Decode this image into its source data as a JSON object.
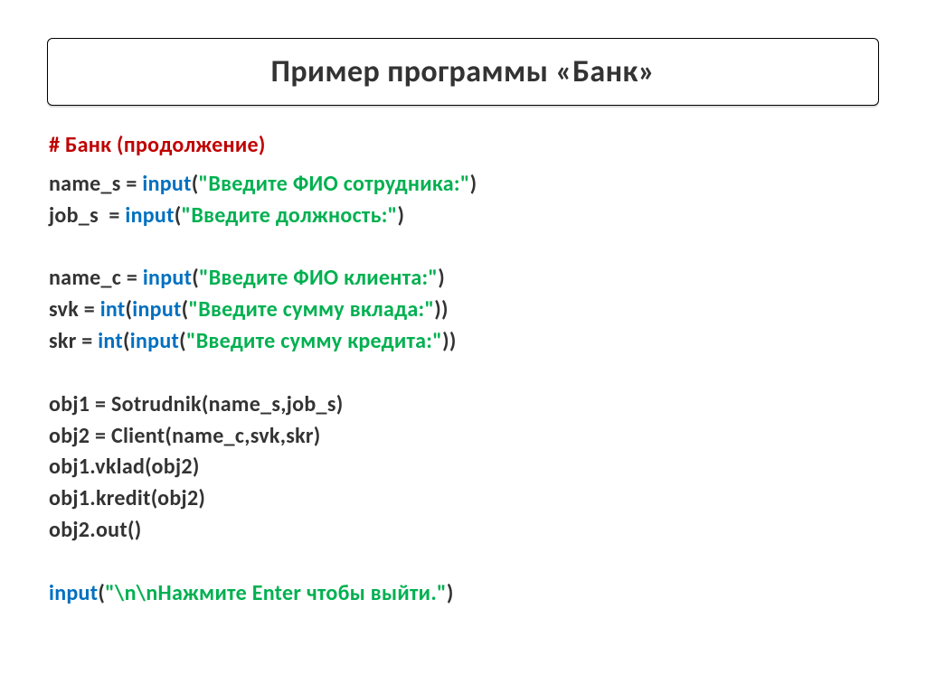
{
  "title": "Пример программы «Банк»",
  "comment": "# Банк (продолжение)",
  "code": {
    "l1": {
      "a": "name_s = ",
      "b": "input",
      "c": "(",
      "d": "\"Введите ФИО сотрудника:\"",
      "e": ")"
    },
    "l2": {
      "a": "job_s  = ",
      "b": "input",
      "c": "(",
      "d": "\"Введите должность:\"",
      "e": ")"
    },
    "l3": {
      "a": "name_c = ",
      "b": "input",
      "c": "(",
      "d": "\"Введите ФИО клиента:\"",
      "e": ")"
    },
    "l4": {
      "a": "svk = ",
      "b": "int",
      "c": "(",
      "d": "input",
      "e": "(",
      "f": "\"Введите сумму вклада:\"",
      "g": "))"
    },
    "l5": {
      "a": "skr = ",
      "b": "int",
      "c": "(",
      "d": "input",
      "e": "(",
      "f": "\"Введите сумму кредита:\"",
      "g": "))"
    },
    "l6": "obj1 = Sotrudnik(name_s,job_s)",
    "l7": "obj2 = Client(name_c,svk,skr)",
    "l8": "obj1.vklad(obj2)",
    "l9": "obj1.kredit(obj2)",
    "l10": "obj2.out()",
    "l11": {
      "a": "input",
      "b": "(",
      "c": "\"\\n\\nНажмите Enter чтобы выйти.\"",
      "d": ")"
    }
  }
}
